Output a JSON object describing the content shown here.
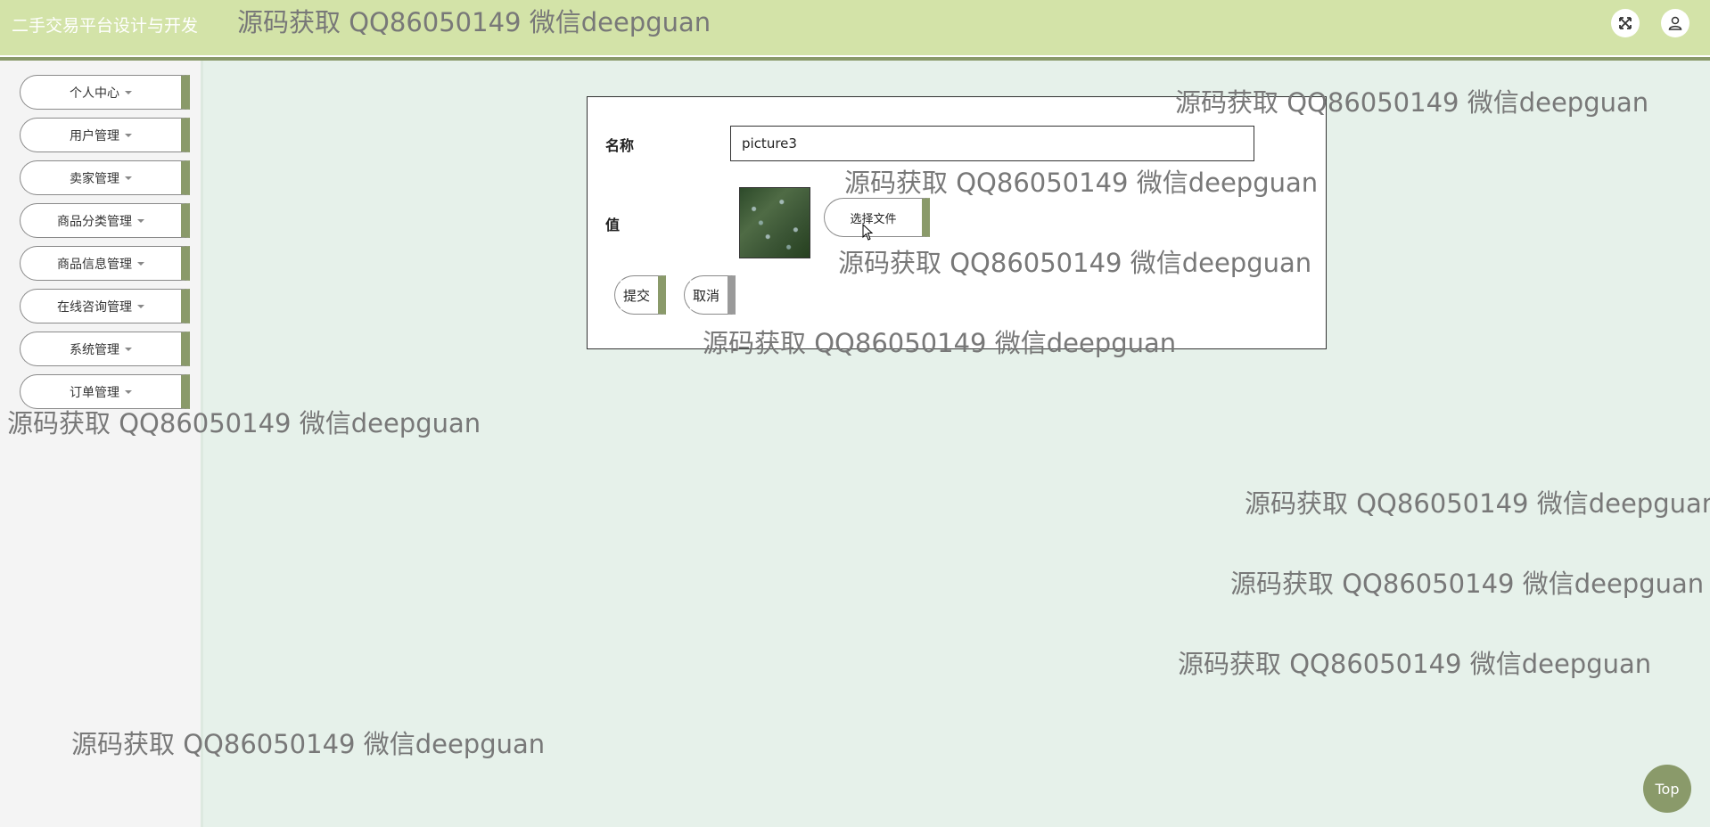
{
  "header": {
    "app_title": "二手交易平台设计与开发",
    "fullscreen_icon": "fullscreen-icon",
    "user_icon": "user-icon"
  },
  "sidebar": {
    "items": [
      {
        "label": "个人中心"
      },
      {
        "label": "用户管理"
      },
      {
        "label": "卖家管理"
      },
      {
        "label": "商品分类管理"
      },
      {
        "label": "商品信息管理"
      },
      {
        "label": "在线咨询管理"
      },
      {
        "label": "系统管理"
      },
      {
        "label": "订单管理"
      }
    ]
  },
  "form": {
    "name_label": "名称",
    "name_value": "picture3",
    "value_label": "值",
    "choose_file_label": "选择文件",
    "submit_label": "提交",
    "cancel_label": "取消"
  },
  "watermark": {
    "text": "源码获取 QQ86050149 微信deepguan"
  },
  "back_to_top": "Top",
  "colors": {
    "header_bg": "#d3e3a8",
    "accent": "#8a9a6a",
    "page_bg": "#e6f1ea",
    "sidebar_bg": "#f4f4f4"
  }
}
